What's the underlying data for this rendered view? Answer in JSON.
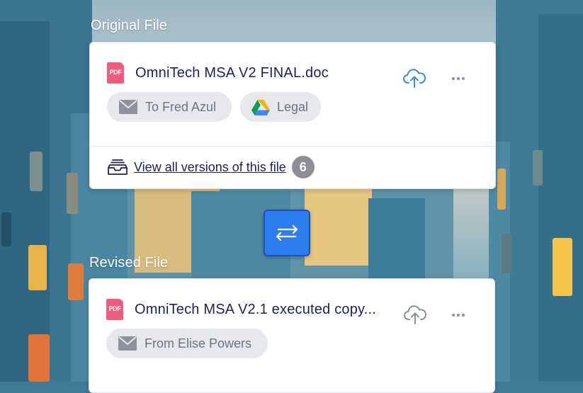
{
  "original": {
    "section_label": "Original File",
    "file_icon_text": "PDF",
    "file_name": "OmniTech MSA V2 FINAL.doc",
    "chips": [
      {
        "label": "To Fred Azul",
        "icon": "mail-icon"
      },
      {
        "label": "Legal",
        "icon": "google-drive-icon"
      }
    ],
    "versions_link": "View all versions of this file",
    "versions_count": "6"
  },
  "revised": {
    "section_label": "Revised File",
    "file_icon_text": "PDF",
    "file_name": "OmniTech MSA V2.1 executed copy...",
    "chips": [
      {
        "label": "From Elise Powers",
        "icon": "mail-icon"
      }
    ]
  },
  "colors": {
    "accent": "#2d7cf0",
    "upload_active": "#3d8bd8",
    "upload_inactive": "#8a8f9e",
    "pdf": "#f25c7c",
    "text_dark": "#1f2155"
  },
  "icons": [
    "pdf-icon",
    "cloud-upload-icon",
    "more-horizontal-icon",
    "mail-icon",
    "google-drive-icon",
    "inbox-versions-icon",
    "swap-arrows-icon"
  ]
}
